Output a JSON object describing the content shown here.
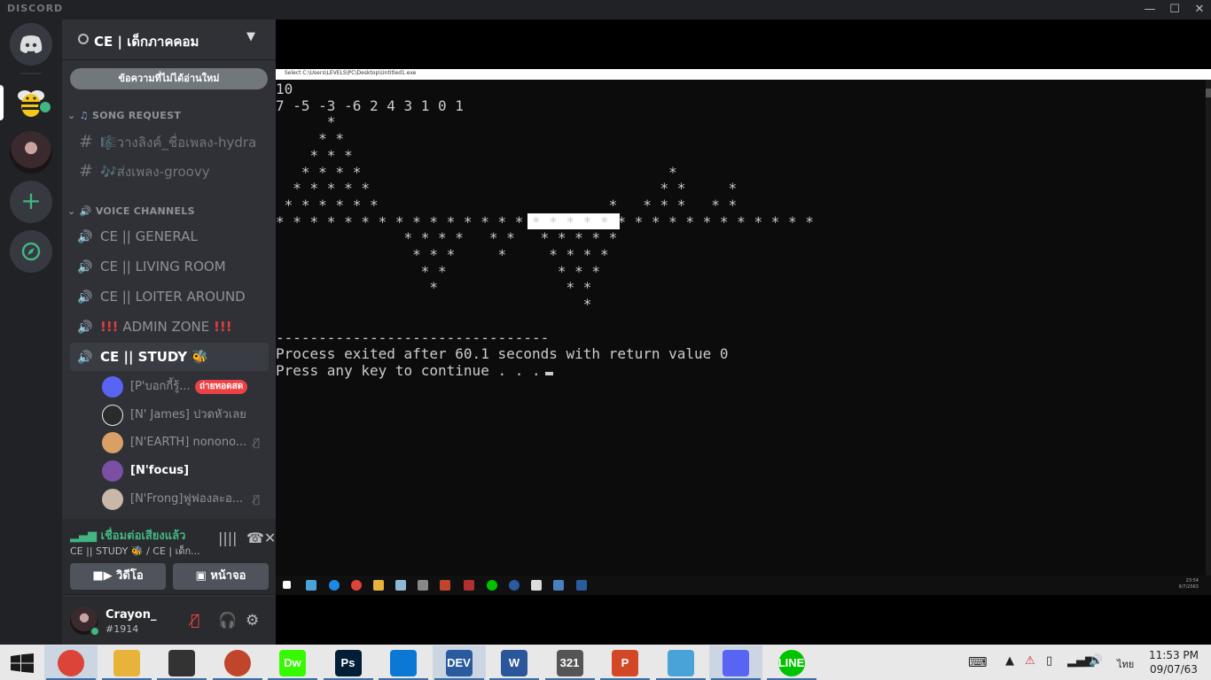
{
  "app": {
    "brand": "DISCORD",
    "minimize": "—",
    "maximize": "☐",
    "close": "✕"
  },
  "server": {
    "name": "CE | เด็กภาคคอม",
    "unread_label": "ข้อความที่ไม่ได้อ่านใหม่"
  },
  "categories": {
    "song_request": "SONG REQUEST",
    "voice_channels": "VOICE CHANNELS"
  },
  "text_channels": [
    {
      "label": "🎼วางลิงค์_ชื่อเพลง-hydra"
    },
    {
      "label": "🎶ส่งเพลง-groovy"
    }
  ],
  "voice_channels": [
    {
      "label": "CE || GENERAL"
    },
    {
      "label": "CE || LIVING ROOM"
    },
    {
      "label": "CE || LOITER AROUND"
    },
    {
      "label": "ADMIN ZONE",
      "prefix": "!!!",
      "suffix": "!!!"
    },
    {
      "label": "CE || STUDY 🐝"
    }
  ],
  "members": [
    {
      "name": "[P'บอกกี้รู้...",
      "badge": "ถ่ายทอดสด",
      "color": "#5865f2"
    },
    {
      "name": "[N' James] ปวดหัวเลย",
      "color": "#2b2b2b"
    },
    {
      "name": "[N'EARTH] nonono...",
      "color": "#d9a066",
      "muted": true
    },
    {
      "name": "[N'focus]",
      "color": "#7b4fa3"
    },
    {
      "name": "[N'Frong]ฟูฟองละอ...",
      "color": "#c9b8a8",
      "muted": true
    }
  ],
  "voice_panel": {
    "status": "เชื่อมต่อเสียงแล้ว",
    "channel": "CE || STUDY 🐝 / CE | เด็ก...",
    "video_label": "วิดีโอ",
    "screen_label": "หน้าจอ"
  },
  "user": {
    "name": "Crayon_",
    "tag": "#1914"
  },
  "console": {
    "title": "Select C:\\Users\\LEVELS\\PC\\Desktop\\Untitled1.exe",
    "lines": [
      "10",
      "7 -5 -3 -6 2 4 3 1 0 1",
      "      *",
      "     * *",
      "    * * *",
      "   * * * *                                    *",
      "  * * * * *                                  * *     *",
      " * * * * * *                           *   * * *   * *",
      "* * * * * * * * * * * * * * * * * * * * * * * * * * * * * * * *",
      "               * * * *   * *   * * * * *",
      "                * * *     *     * * * *",
      "                 * *             * * *",
      "                  *               * *",
      "                                    *",
      "",
      "--------------------------------",
      "Process exited after 60.1 seconds with return value 0",
      "Press any key to continue . . ."
    ],
    "inner_clock_time": "23:54",
    "inner_clock_date": "9/7/2563"
  },
  "taskbar": {
    "apps": [
      {
        "name": "chrome",
        "label": "",
        "color": "#db4437",
        "active": true
      },
      {
        "name": "file-explorer",
        "label": "",
        "color": "#e8b33a",
        "active": false
      },
      {
        "name": "alien-app",
        "label": "",
        "color": "#333333",
        "active": false
      },
      {
        "name": "circle-app",
        "label": "",
        "color": "#c0452b",
        "active": false
      },
      {
        "name": "dreamweaver",
        "label": "Dw",
        "color": "#35fa00",
        "active": false
      },
      {
        "name": "photoshop",
        "label": "Ps",
        "color": "#001e36",
        "active": false
      },
      {
        "name": "vscode",
        "label": "",
        "color": "#0a78d4",
        "active": false
      },
      {
        "name": "devcpp",
        "label": "DEV",
        "color": "#2a5b9e",
        "active": true
      },
      {
        "name": "word",
        "label": "W",
        "color": "#2b579a",
        "active": false
      },
      {
        "name": "media-player",
        "label": "321",
        "color": "#555555",
        "active": false
      },
      {
        "name": "powerpoint",
        "label": "P",
        "color": "#d24726",
        "active": false
      },
      {
        "name": "notes-app",
        "label": "",
        "color": "#4aa3d8",
        "active": false
      },
      {
        "name": "discord",
        "label": "",
        "color": "#5865f2",
        "active": true
      },
      {
        "name": "line",
        "label": "LINE",
        "color": "#00c300",
        "active": false
      }
    ],
    "lang": "ไทย",
    "time": "11:53 PM",
    "date": "09/07/63"
  }
}
